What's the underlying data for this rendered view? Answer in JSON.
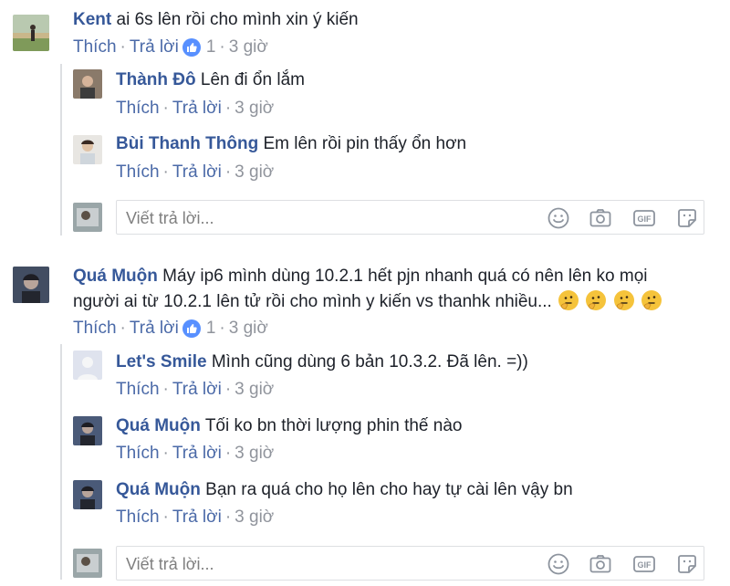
{
  "threads": [
    {
      "comment": {
        "author": "Kent",
        "text": "ai 6s lên rồi cho mình xin ý kiến",
        "like_label": "Thích",
        "reply_label": "Trả lời",
        "reactions": "1",
        "time": "3 giờ"
      },
      "replies": [
        {
          "author": "Thành Đô",
          "text": "Lên đi ổn lắm",
          "like_label": "Thích",
          "reply_label": "Trả lời",
          "time": "3 giờ"
        },
        {
          "author": "Bùi Thanh Thông",
          "text": "Em lên rồi pin thấy ổn hơn",
          "like_label": "Thích",
          "reply_label": "Trả lời",
          "time": "3 giờ"
        }
      ],
      "reply_box": {
        "placeholder": "Viết trả lời..."
      }
    },
    {
      "comment": {
        "author": "Quá Muộn",
        "text_line1": "Máy ip6 mình dùng 10.2.1 hết pjn nhanh quá có nên lên ko mọi",
        "text_line2": "người ai từ 10.2.1 lên tử rồi cho mình y kiến vs thanhk nhiều...",
        "like_label": "Thích",
        "reply_label": "Trả lời",
        "reactions": "1",
        "time": "3 giờ"
      },
      "replies": [
        {
          "author": "Let's Smile",
          "text": "Mình cũng dùng 6 bản 10.3.2. Đã lên. =))",
          "like_label": "Thích",
          "reply_label": "Trả lời",
          "time": "3 giờ"
        },
        {
          "author": "Quá Muộn",
          "text": "Tối ko bn thời lượng phin thế nào",
          "like_label": "Thích",
          "reply_label": "Trả lời",
          "time": "3 giờ"
        },
        {
          "author": "Quá Muộn",
          "text": "Bạn ra quá cho họ lên cho hay tự cài lên vậy bn",
          "like_label": "Thích",
          "reply_label": "Trả lời",
          "time": "3 giờ"
        }
      ],
      "reply_box": {
        "placeholder": "Viết trả lời..."
      }
    }
  ],
  "separator": "·",
  "icons": [
    "like-icon",
    "emoji-icon",
    "camera-icon",
    "gif-icon",
    "sticker-icon",
    "thinking-face-icon"
  ],
  "colors": {
    "name": "#365899",
    "action": "#4b6aa8",
    "meta": "#90949c",
    "like": "#5890ff"
  }
}
